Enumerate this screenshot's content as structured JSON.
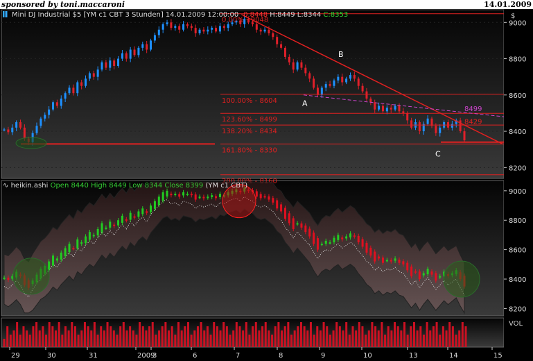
{
  "header": {
    "sponsor": "sponsored by toni.maccaroni",
    "date": "14.01.2009"
  },
  "panel1": {
    "name": "Mini DJ Industrial $5 [YM c1 CBT  3 Stunden]",
    "datetime": "14.01.2009 12:00:00",
    "change": "-",
    "change_value": "0.8448",
    "high_label": "H:8449",
    "low_label": "L:8344",
    "close_label": "C:8353",
    "currency": "$"
  },
  "panel2": {
    "indicator": "heikin.ashi",
    "stats": "Open 8440 High 8449 Low 8344 Close 8399",
    "symbol": "(YM c1 CBT)"
  },
  "volume_label": "VOL",
  "colors": {
    "up": "#1e90ff",
    "down": "#e0202a",
    "ha_up": "#22cc22",
    "ha_down": "#e01020",
    "trendline": "#e02020",
    "magenta": "#cc44cc",
    "fib_text": "#e02020",
    "grid": "#555555",
    "volume": "#cc1122"
  },
  "chart_data": [
    {
      "type": "candlestick",
      "title": "Mini DJ Industrial $5 [YM c1 CBT  3 Stunden]",
      "y_ticks": [
        9000,
        8800,
        8600,
        8400,
        8200
      ],
      "ylim": [
        8140,
        9070
      ],
      "x_ticks": [
        "29",
        "30",
        "31",
        "2009",
        "3",
        "6",
        "7",
        "8",
        "9",
        "10",
        "13",
        "14",
        "15"
      ],
      "fib_levels": [
        {
          "label": "0.00% - 9048",
          "value": 9048
        },
        {
          "label": "100.00% - 8604",
          "value": 8604
        },
        {
          "label": "123.60% - 8499",
          "value": 8499
        },
        {
          "label": "138.20% - 8434",
          "value": 8434
        },
        {
          "label": "161.80% - 8330",
          "value": 8330
        },
        {
          "label": "200.00% - 8160",
          "value": 8160
        }
      ],
      "annotations": [
        "A",
        "B",
        "C"
      ],
      "right_labels": [
        {
          "label": "8499",
          "value": 8499
        },
        {
          "label": "8429",
          "value": 8429
        }
      ],
      "close": [
        8410,
        8395,
        8420,
        8450,
        8420,
        8360,
        8340,
        8390,
        8430,
        8470,
        8490,
        8520,
        8560,
        8540,
        8580,
        8610,
        8640,
        8610,
        8670,
        8650,
        8690,
        8720,
        8700,
        8740,
        8780,
        8750,
        8790,
        8760,
        8800,
        8830,
        8800,
        8850,
        8820,
        8860,
        8880,
        8850,
        8900,
        8930,
        8960,
        8990,
        9000,
        8970,
        8980,
        8960,
        8990,
        8980,
        8970,
        8940,
        8960,
        8950,
        8960,
        8970,
        8950,
        8980,
        8970,
        8990,
        9000,
        9010,
        8990,
        9020,
        9000,
        8990,
        8960,
        8950,
        8960,
        8940,
        8920,
        8880,
        8860,
        8810,
        8780,
        8740,
        8780,
        8750,
        8720,
        8690,
        8640,
        8600,
        8640,
        8660,
        8650,
        8680,
        8700,
        8670,
        8690,
        8710,
        8690,
        8650,
        8620,
        8580,
        8560,
        8520,
        8540,
        8510,
        8530,
        8520,
        8540,
        8510,
        8500,
        8460,
        8420,
        8450,
        8400,
        8440,
        8470,
        8430,
        8390,
        8420,
        8450,
        8420,
        8440,
        8460,
        8400,
        8350
      ]
    },
    {
      "type": "candlestick",
      "title": "heikin.ashi",
      "y_ticks": [
        9000,
        8800,
        8600,
        8400,
        8200
      ],
      "ylim": [
        8150,
        9070
      ],
      "series": [
        {
          "name": "Open",
          "value": 8440
        },
        {
          "name": "High",
          "value": 8449
        },
        {
          "name": "Low",
          "value": 8344
        },
        {
          "name": "Close",
          "value": 8399
        }
      ]
    },
    {
      "type": "bar",
      "title": "VOL",
      "values": [
        2,
        5,
        3,
        4,
        6,
        3,
        5,
        4,
        3,
        5,
        6,
        4,
        5,
        3,
        6,
        5,
        4,
        6,
        3,
        5,
        4,
        6,
        5,
        3,
        4,
        6,
        5,
        4,
        6,
        3,
        5,
        4,
        6,
        5,
        4,
        3,
        5,
        6,
        4,
        5,
        4,
        3,
        6,
        5,
        4,
        5,
        6,
        3,
        4,
        5,
        6,
        4,
        5,
        3,
        6,
        4,
        5,
        6,
        3,
        4,
        5,
        6,
        4,
        5,
        3,
        6,
        5,
        4,
        6,
        5,
        3,
        4,
        6,
        5,
        4,
        6,
        3,
        5,
        6,
        4,
        5,
        6,
        4,
        3,
        5,
        6,
        4,
        5,
        6,
        3,
        4,
        5,
        6,
        5,
        4,
        6,
        3,
        5,
        4,
        6,
        5,
        3,
        4,
        6,
        5,
        4,
        6,
        3,
        5,
        4,
        6,
        5,
        3,
        4,
        6,
        5,
        4,
        6,
        3,
        5,
        4,
        6,
        5,
        4,
        6,
        3,
        5,
        6,
        4,
        5,
        3,
        6,
        4,
        5,
        6,
        3,
        5,
        4,
        6,
        5,
        3,
        4,
        6,
        5
      ]
    }
  ]
}
